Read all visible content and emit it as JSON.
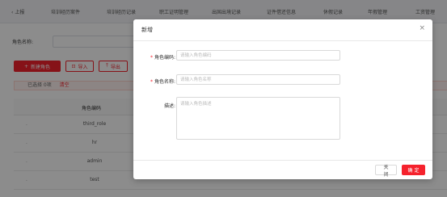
{
  "nav": {
    "items": [
      "上报",
      "培训经历案件",
      "培训经历记录",
      "职工证明管理",
      "出国出境记录",
      "证件借还信息",
      "休假记录",
      "年假管理",
      "工资管理"
    ]
  },
  "search": {
    "label": "角色名称:"
  },
  "toolbar": {
    "add_label": "新建角色",
    "import_label": "导入",
    "export_label": "导出"
  },
  "alert": {
    "text": "已选择 0项",
    "clear_label": "清空"
  },
  "table": {
    "header_code": "角色编码",
    "rows": [
      {
        "code": "third_role"
      },
      {
        "code": "hr"
      },
      {
        "code": "admin"
      },
      {
        "code": "test"
      }
    ]
  },
  "modal": {
    "title": "新增",
    "close_symbol": "×",
    "fields": {
      "code": {
        "label": "角色编码:",
        "placeholder": "请输入角色编码",
        "required": true
      },
      "name": {
        "label": "角色名称:",
        "placeholder": "请输入角色名称",
        "required": true
      },
      "desc": {
        "label": "描述:",
        "placeholder": "请输入角色描述",
        "required": false
      }
    },
    "required_mark": "*",
    "footer": {
      "close_label": "关 闭",
      "ok_label": "确 定"
    }
  },
  "colors": {
    "accent": "#f5222d",
    "overlay": "rgba(0,0,0,0.45)"
  }
}
